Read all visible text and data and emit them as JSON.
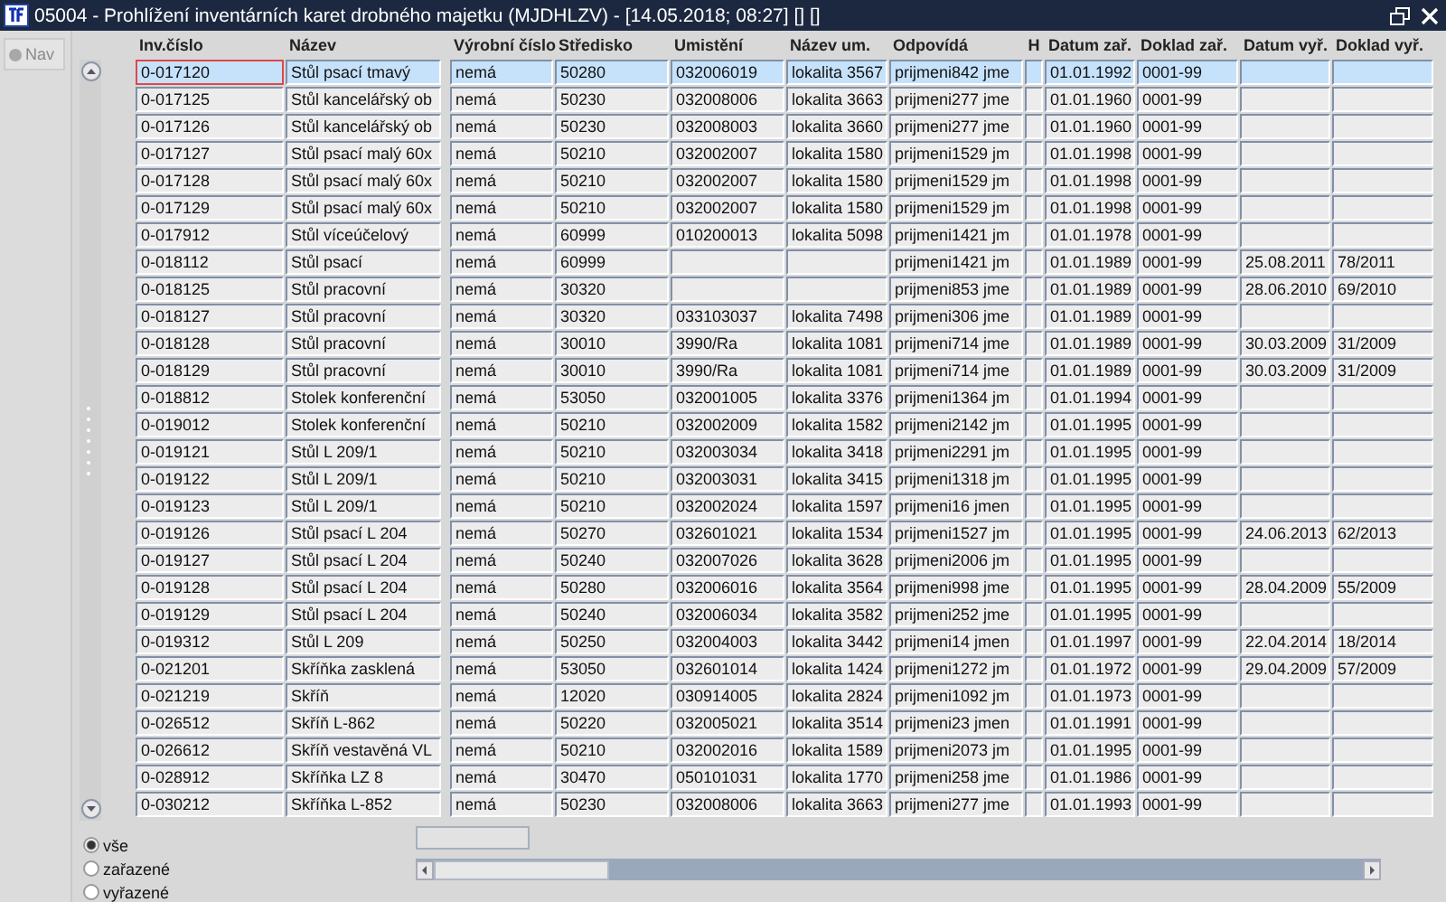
{
  "window": {
    "title": "05004 - Prohlížení inventárních karet drobného majetku (MJDHLZV) - [14.05.2018; 08:27] [] []"
  },
  "nav": {
    "label": "Nav"
  },
  "table": {
    "columns": [
      "Inv.číslo",
      "Název",
      "Výrobní číslo",
      "Středisko",
      "Umistění",
      "Název um.",
      "Odpovídá",
      "H",
      "Datum zař.",
      "Doklad zař.",
      "Datum vyř.",
      "Doklad vyř."
    ],
    "rows": [
      {
        "selected": true,
        "cells": [
          "0-017120",
          "Stůl psací tmavý",
          "nemá",
          "50280",
          "032006019",
          "lokalita 3567",
          "prijmeni842 jme",
          null,
          "01.01.1992",
          "0001-99",
          null,
          null
        ]
      },
      {
        "selected": false,
        "cells": [
          "0-017125",
          "Stůl kancelářský ob",
          "nemá",
          "50230",
          "032008006",
          "lokalita 3663",
          "prijmeni277 jme",
          null,
          "01.01.1960",
          "0001-99",
          null,
          null
        ]
      },
      {
        "selected": false,
        "cells": [
          "0-017126",
          "Stůl kancelářský ob",
          "nemá",
          "50230",
          "032008003",
          "lokalita 3660",
          "prijmeni277 jme",
          null,
          "01.01.1960",
          "0001-99",
          null,
          null
        ]
      },
      {
        "selected": false,
        "cells": [
          "0-017127",
          "Stůl psací malý 60x",
          "nemá",
          "50210",
          "032002007",
          "lokalita 1580",
          "prijmeni1529 jm",
          null,
          "01.01.1998",
          "0001-99",
          null,
          null
        ]
      },
      {
        "selected": false,
        "cells": [
          "0-017128",
          "Stůl psací malý 60x",
          "nemá",
          "50210",
          "032002007",
          "lokalita 1580",
          "prijmeni1529 jm",
          null,
          "01.01.1998",
          "0001-99",
          null,
          null
        ]
      },
      {
        "selected": false,
        "cells": [
          "0-017129",
          "Stůl psací malý 60x",
          "nemá",
          "50210",
          "032002007",
          "lokalita 1580",
          "prijmeni1529 jm",
          null,
          "01.01.1998",
          "0001-99",
          null,
          null
        ]
      },
      {
        "selected": false,
        "cells": [
          "0-017912",
          "Stůl víceúčelový",
          "nemá",
          "60999",
          "010200013",
          "lokalita 5098",
          "prijmeni1421 jm",
          null,
          "01.01.1978",
          "0001-99",
          null,
          null
        ]
      },
      {
        "selected": false,
        "cells": [
          "0-018112",
          "Stůl psací",
          "nemá",
          "60999",
          null,
          null,
          "prijmeni1421 jm",
          null,
          "01.01.1989",
          "0001-99",
          "25.08.2011",
          "78/2011"
        ]
      },
      {
        "selected": false,
        "cells": [
          "0-018125",
          "Stůl pracovní",
          "nemá",
          "30320",
          null,
          null,
          "prijmeni853 jme",
          null,
          "01.01.1989",
          "0001-99",
          "28.06.2010",
          "69/2010"
        ]
      },
      {
        "selected": false,
        "cells": [
          "0-018127",
          "Stůl pracovní",
          "nemá",
          "30320",
          "033103037",
          "lokalita 7498",
          "prijmeni306 jme",
          null,
          "01.01.1989",
          "0001-99",
          null,
          null
        ]
      },
      {
        "selected": false,
        "cells": [
          "0-018128",
          "Stůl pracovní",
          "nemá",
          "30010",
          "3990/Ra",
          "lokalita 1081",
          "prijmeni714 jme",
          null,
          "01.01.1989",
          "0001-99",
          "30.03.2009",
          "31/2009"
        ]
      },
      {
        "selected": false,
        "cells": [
          "0-018129",
          "Stůl pracovní",
          "nemá",
          "30010",
          "3990/Ra",
          "lokalita 1081",
          "prijmeni714 jme",
          null,
          "01.01.1989",
          "0001-99",
          "30.03.2009",
          "31/2009"
        ]
      },
      {
        "selected": false,
        "cells": [
          "0-018812",
          "Stolek konferenční",
          "nemá",
          "53050",
          "032001005",
          "lokalita 3376",
          "prijmeni1364 jm",
          null,
          "01.01.1994",
          "0001-99",
          null,
          null
        ]
      },
      {
        "selected": false,
        "cells": [
          "0-019012",
          "Stolek konferenční",
          "nemá",
          "50210",
          "032002009",
          "lokalita 1582",
          "prijmeni2142 jm",
          null,
          "01.01.1995",
          "0001-99",
          null,
          null
        ]
      },
      {
        "selected": false,
        "cells": [
          "0-019121",
          "Stůl L 209/1",
          "nemá",
          "50210",
          "032003034",
          "lokalita 3418",
          "prijmeni2291 jm",
          null,
          "01.01.1995",
          "0001-99",
          null,
          null
        ]
      },
      {
        "selected": false,
        "cells": [
          "0-019122",
          "Stůl L 209/1",
          "nemá",
          "50210",
          "032003031",
          "lokalita 3415",
          "prijmeni1318 jm",
          null,
          "01.01.1995",
          "0001-99",
          null,
          null
        ]
      },
      {
        "selected": false,
        "cells": [
          "0-019123",
          "Stůl L 209/1",
          "nemá",
          "50210",
          "032002024",
          "lokalita 1597",
          "prijmeni16 jmen",
          null,
          "01.01.1995",
          "0001-99",
          null,
          null
        ]
      },
      {
        "selected": false,
        "cells": [
          "0-019126",
          "Stůl psací L 204",
          "nemá",
          "50270",
          "032601021",
          "lokalita 1534",
          "prijmeni1527 jm",
          null,
          "01.01.1995",
          "0001-99",
          "24.06.2013",
          "62/2013"
        ]
      },
      {
        "selected": false,
        "cells": [
          "0-019127",
          "Stůl psací L 204",
          "nemá",
          "50240",
          "032007026",
          "lokalita 3628",
          "prijmeni2006 jm",
          null,
          "01.01.1995",
          "0001-99",
          null,
          null
        ]
      },
      {
        "selected": false,
        "cells": [
          "0-019128",
          "Stůl psací L 204",
          "nemá",
          "50280",
          "032006016",
          "lokalita 3564",
          "prijmeni998 jme",
          null,
          "01.01.1995",
          "0001-99",
          "28.04.2009",
          "55/2009"
        ]
      },
      {
        "selected": false,
        "cells": [
          "0-019129",
          "Stůl psací L 204",
          "nemá",
          "50240",
          "032006034",
          "lokalita 3582",
          "prijmeni252 jme",
          null,
          "01.01.1995",
          "0001-99",
          null,
          null
        ]
      },
      {
        "selected": false,
        "cells": [
          "0-019312",
          "Stůl L 209",
          "nemá",
          "50250",
          "032004003",
          "lokalita 3442",
          "prijmeni14 jmen",
          null,
          "01.01.1997",
          "0001-99",
          "22.04.2014",
          "18/2014"
        ]
      },
      {
        "selected": false,
        "cells": [
          "0-021201",
          "Skříňka zasklená",
          "nemá",
          "53050",
          "032601014",
          "lokalita 1424",
          "prijmeni1272 jm",
          null,
          "01.01.1972",
          "0001-99",
          "29.04.2009",
          "57/2009"
        ]
      },
      {
        "selected": false,
        "cells": [
          "0-021219",
          "Skříň",
          "nemá",
          "12020",
          "030914005",
          "lokalita 2824",
          "prijmeni1092 jm",
          null,
          "01.01.1973",
          "0001-99",
          null,
          null
        ]
      },
      {
        "selected": false,
        "cells": [
          "0-026512",
          "Skříň L-862",
          "nemá",
          "50220",
          "032005021",
          "lokalita 3514",
          "prijmeni23 jmen",
          null,
          "01.01.1991",
          "0001-99",
          null,
          null
        ]
      },
      {
        "selected": false,
        "cells": [
          "0-026612",
          "Skříň vestavěná VL",
          "nemá",
          "50210",
          "032002016",
          "lokalita 1589",
          "prijmeni2073 jm",
          null,
          "01.01.1995",
          "0001-99",
          null,
          null
        ]
      },
      {
        "selected": false,
        "cells": [
          "0-028912",
          "Skříňka LZ 8",
          "nemá",
          "30470",
          "050101031",
          "lokalita 1770",
          "prijmeni258 jme",
          null,
          "01.01.1986",
          "0001-99",
          null,
          null
        ]
      },
      {
        "selected": false,
        "cells": [
          "0-030212",
          "Skříňka L-852",
          "nemá",
          "50230",
          "032008006",
          "lokalita 3663",
          "prijmeni277 jme",
          null,
          "01.01.1993",
          "0001-99",
          null,
          null
        ]
      }
    ]
  },
  "filter": [
    {
      "label": "vše",
      "selected": true
    },
    {
      "label": "zařazené",
      "selected": false
    },
    {
      "label": "vyřazené",
      "selected": false
    }
  ]
}
